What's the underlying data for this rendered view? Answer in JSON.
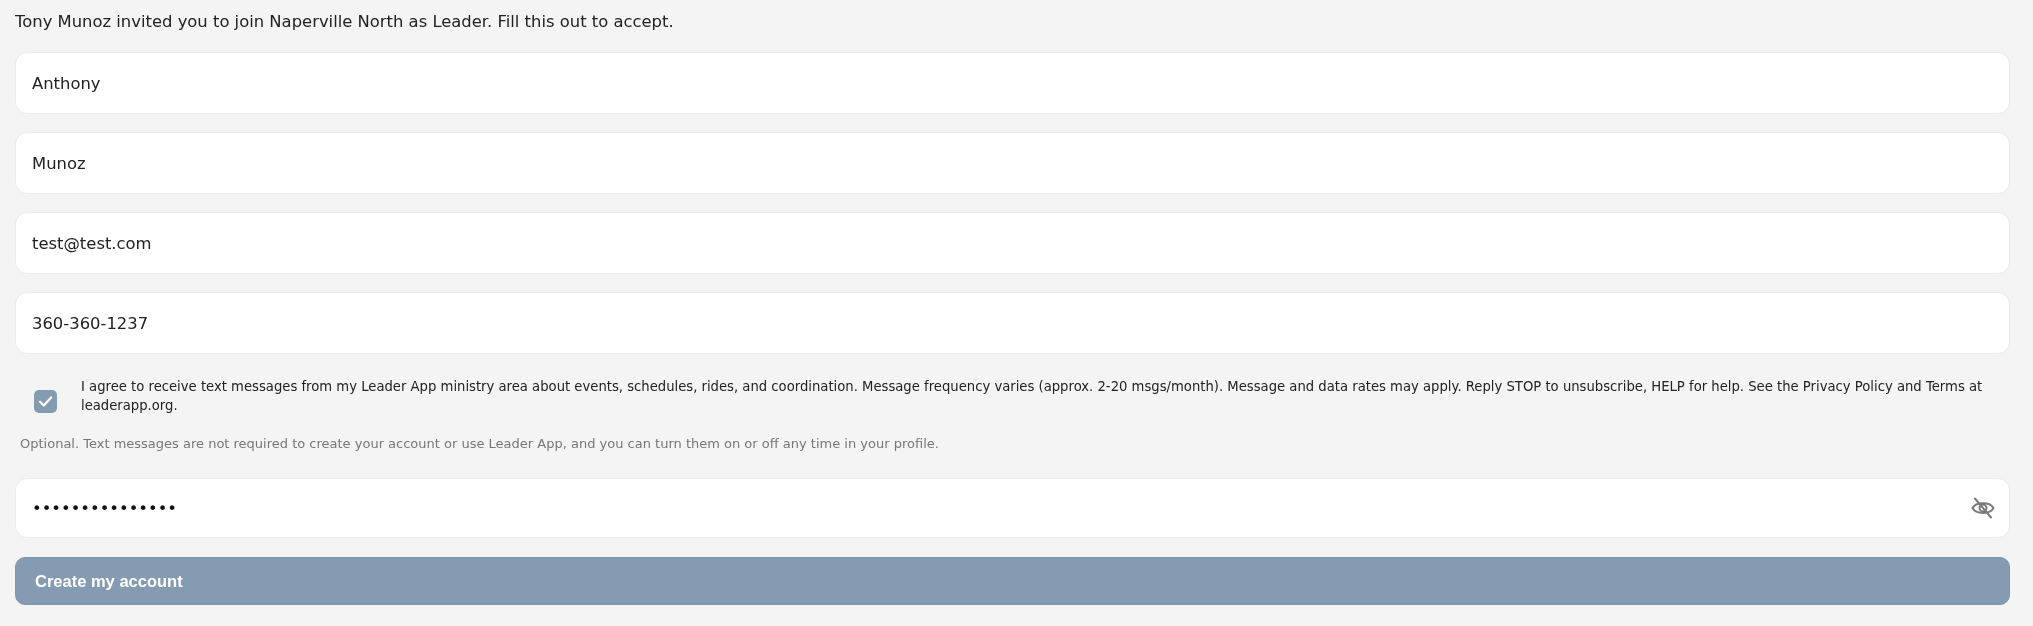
{
  "intro": "Tony Munoz invited you to join Naperville North as Leader. Fill this out to accept.",
  "fields": [
    {
      "kind": "text",
      "value": "Anthony"
    },
    {
      "kind": "text",
      "value": "Munoz"
    },
    {
      "kind": "text",
      "value": "test@test.com"
    },
    {
      "kind": "text",
      "value": "360-360-1237"
    }
  ],
  "sms_consent": {
    "checked": true,
    "label": "I agree to receive text messages from my Leader App ministry area about events, schedules, rides, and coordination. Message frequency varies (approx. 2-20 msgs/month). Message and data rates may apply. Reply STOP to unsubscribe, HELP for help. See the Privacy Policy and Terms at leaderapp.org."
  },
  "note": "Optional. Text messages are not required to create your account or use Leader App, and you can turn them on or off any time in your profile.",
  "password": {
    "kind": "password",
    "value": "•••••••••••••••",
    "visible": false
  },
  "submit": {
    "label": "Create my account"
  }
}
